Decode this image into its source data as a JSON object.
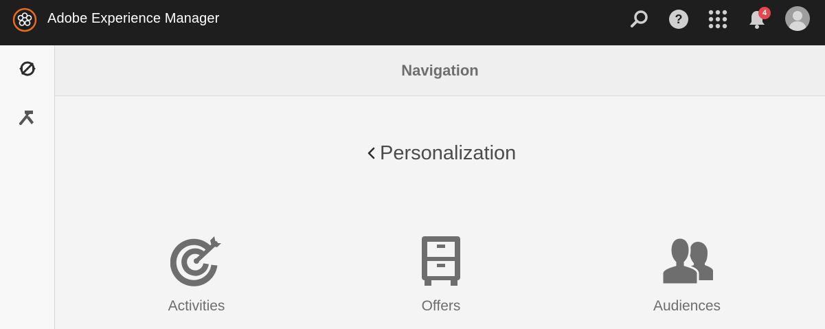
{
  "app": {
    "title": "Adobe Experience Manager",
    "logo_icon": "aem-logo-icon"
  },
  "topbar": {
    "search_icon": "search-icon",
    "help_icon": "help-icon",
    "apps_icon": "apps-grid-icon",
    "notifications_icon": "bell-icon",
    "notifications_count": "4",
    "avatar_icon": "user-avatar-icon"
  },
  "rail": {
    "items": [
      {
        "icon": "navigation-compass-icon"
      },
      {
        "icon": "tools-hammer-icon"
      }
    ]
  },
  "header": {
    "title": "Navigation"
  },
  "section": {
    "back_label": "Personalization"
  },
  "tiles": [
    {
      "label": "Activities",
      "icon": "target-icon"
    },
    {
      "label": "Offers",
      "icon": "cabinet-icon"
    },
    {
      "label": "Audiences",
      "icon": "users-icon"
    }
  ],
  "colors": {
    "topbar_bg": "#1e1e1e",
    "brand_orange": "#e86b1f",
    "badge_red": "#e34850",
    "icon_gray": "#6e6e6e"
  }
}
